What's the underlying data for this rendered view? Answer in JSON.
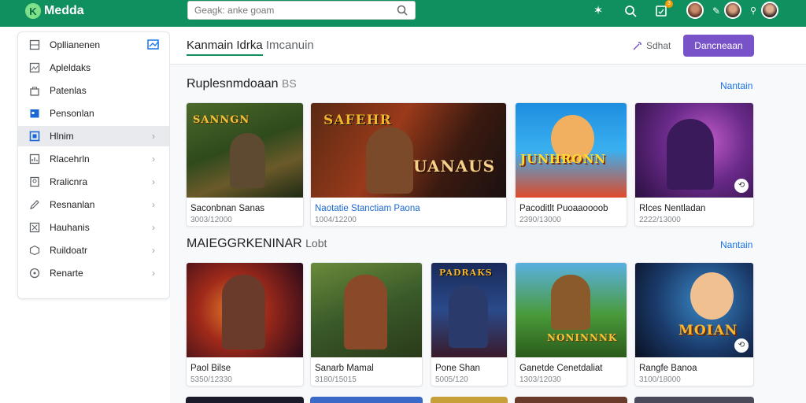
{
  "topbar": {
    "app_name": "Medda",
    "logo_glyph": "K",
    "search_placeholder": "Geagk: anke goam",
    "badge_count": "3",
    "icons": [
      "star-icon",
      "search-icon",
      "notification-icon",
      "user-avatar",
      "edit-icon",
      "user-avatar",
      "location-icon",
      "user-avatar"
    ]
  },
  "sidebar": {
    "items": [
      {
        "label": "Opllianenen",
        "icon": "grid-icon"
      },
      {
        "label": "Apleldaks",
        "icon": "image-icon"
      },
      {
        "label": "Patenlas",
        "icon": "bag-icon"
      },
      {
        "label": "Pensonlan",
        "icon": "calendar-icon"
      },
      {
        "label": "Hlnim",
        "icon": "square-icon"
      },
      {
        "label": "Rlacehrln",
        "icon": "chart-icon"
      },
      {
        "label": "Rralicnra",
        "icon": "document-icon"
      },
      {
        "label": "Resnanlan",
        "icon": "pencil-icon"
      },
      {
        "label": "Hauhanis",
        "icon": "puzzle-icon"
      },
      {
        "label": "Ruildoatr",
        "icon": "cube-icon"
      },
      {
        "label": "Renarte",
        "icon": "help-icon"
      }
    ],
    "chevron": "›"
  },
  "header": {
    "title_primary": "Kanmain Idrka",
    "title_secondary": "Imcanuin",
    "link_label": "Sdhat",
    "button_label": "Dancneaan"
  },
  "sections": [
    {
      "title": "Ruplesnmdoaan",
      "title_suffix": "BS",
      "link": "Nantain",
      "cards": [
        {
          "name": "Saconbnan Sanas",
          "meta": "3003/12000",
          "art_text": "SANNGN",
          "blue": false
        },
        {
          "name": "Naotatie Stanctiam Paona",
          "meta": "1004/12200",
          "art_text": "UANAUS",
          "blue": true
        },
        {
          "name": "Pacoditlt Puoaaoooob",
          "meta": "2390/13000",
          "art_text": "JUNHRONN",
          "blue": false
        },
        {
          "name": "Rlces Nentladan",
          "meta": "2222/13000",
          "art_text": "",
          "blue": false
        }
      ]
    },
    {
      "title": "MAIEGGRKENINAR",
      "title_suffix": "Lobt",
      "link": "Nantain",
      "cards": [
        {
          "name": "Paol Bilse",
          "meta": "5350/12330",
          "art_text": "",
          "blue": false
        },
        {
          "name": "Sanarb Mamal",
          "meta": "3180/15015",
          "art_text": "",
          "blue": false
        },
        {
          "name": "Pone Shan",
          "meta": "5005/120",
          "art_text": "PADRAKS",
          "blue": false
        },
        {
          "name": "Ganetde Cenetdaliat",
          "meta": "1303/12030",
          "art_text": "NONINNNK",
          "blue": false
        },
        {
          "name": "Rangfe Banoa",
          "meta": "3100/18000",
          "art_text": "MOIAN",
          "blue": false
        }
      ]
    }
  ],
  "colors": {
    "topbar": "#11905f",
    "accent": "#7752c8",
    "link": "#1a73e8"
  }
}
